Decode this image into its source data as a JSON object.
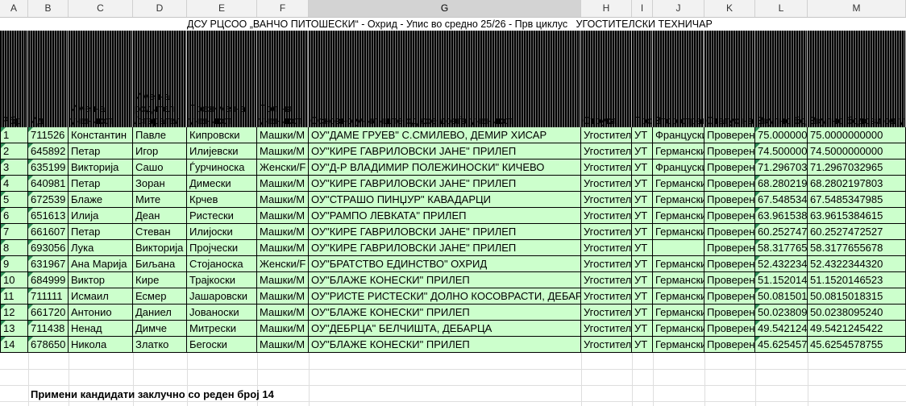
{
  "column_headers": [
    "A",
    "B",
    "C",
    "D",
    "E",
    "F",
    "G",
    "H",
    "I",
    "J",
    "K",
    "L",
    "M"
  ],
  "selected_column": "G",
  "title": "ДСУ РЦСОО „ВАНЧО ПИТОШЕСКИ“ - Охрид - Упис во средно 25/26 - Прв циклус   УГОСТИТЕЛСКИ ТЕХНИЧАР",
  "header": {
    "a": "Р.бр",
    "b": "Ид",
    "c": "Име на\nученикот",
    "d": "Име на\nродител\n/старател",
    "e": "Презиме на\nученикот",
    "f": "Пол на\nученикот",
    "g": "Основно училиште од кое доаѓа ученикот",
    "h": "Струка",
    "i": "Профил",
    "j": "Втор странски јазик",
    "k": "Статус на",
    "l": "Вкупно бодови",
    "m": "Вкупно бодови од успех"
  },
  "rows": [
    {
      "a": "1",
      "b": "711526",
      "c": "Константин",
      "d": "Павле",
      "e": "Кипровски",
      "f": "Машки/М",
      "g": "ОУ\"ДАМЕ ГРУЕВ\" С.СМИЛЕВО, ДЕМИР ХИСАР",
      "h": "Угостител",
      "i": "УТ",
      "j": "Француски",
      "k": "Проверен",
      "l": "75.000000",
      "m": "75.0000000000"
    },
    {
      "a": "2",
      "b": "645892",
      "c": "Петар",
      "d": "Игор",
      "e": "Илијевски",
      "f": "Машки/М",
      "g": "ОУ\"КИРЕ ГАВРИЛОВСКИ ЈАНЕ\" ПРИЛЕП",
      "h": "Угостител",
      "i": "УТ",
      "j": "Германски",
      "k": "Проверен",
      "l": "74.500000",
      "m": "74.5000000000"
    },
    {
      "a": "3",
      "b": "635199",
      "c": "Викторија",
      "d": "Сашо",
      "e": "Ѓурчиноска",
      "f": "Женски/F",
      "g": "ОУ\"Д-Р ВЛАДИМИР ПОЛЕЖИНОСКИ\" КИЧЕВО",
      "h": "Угостител",
      "i": "УТ",
      "j": "Француски",
      "k": "Проверен",
      "l": "71.296703",
      "m": "71.2967032965"
    },
    {
      "a": "4",
      "b": "640981",
      "c": "Петар",
      "d": "Зоран",
      "e": "Димески",
      "f": "Машки/М",
      "g": "ОУ\"КИРЕ ГАВРИЛОВСКИ ЈАНЕ\" ПРИЛЕП",
      "h": "Угостител",
      "i": "УТ",
      "j": "Германски",
      "k": "Проверен",
      "l": "68.280219",
      "m": "68.2802197803"
    },
    {
      "a": "5",
      "b": "672539",
      "c": "Блаже",
      "d": "Мите",
      "e": "Крчев",
      "f": "Машки/М",
      "g": "ОУ\"СТРАШО ПИНЏУР\" КАВАДАРЦИ",
      "h": "Угостител",
      "i": "УТ",
      "j": "Германски",
      "k": "Проверен",
      "l": "67.548534",
      "m": "67.5485347985"
    },
    {
      "a": "6",
      "b": "651613",
      "c": "Илија",
      "d": "Деан",
      "e": "Ристески",
      "f": "Машки/М",
      "g": "ОУ\"РАМПО ЛЕВКАТА\" ПРИЛЕП",
      "h": "Угостител",
      "i": "УТ",
      "j": "Германски",
      "k": "Проверен",
      "l": "63.961538",
      "m": "63.9615384615"
    },
    {
      "a": "7",
      "b": "661607",
      "c": "Петар",
      "d": "Стеван",
      "e": "Илијоски",
      "f": "Машки/М",
      "g": "ОУ\"КИРЕ ГАВРИЛОВСКИ ЈАНЕ\" ПРИЛЕП",
      "h": "Угостител",
      "i": "УТ",
      "j": "Германски",
      "k": "Проверен",
      "l": "60.252747",
      "m": "60.2527472527"
    },
    {
      "a": "8",
      "b": "693056",
      "c": "Лука",
      "d": "Викторија",
      "e": "Пројчески",
      "f": "Машки/М",
      "g": "ОУ\"КИРЕ ГАВРИЛОВСКИ ЈАНЕ\" ПРИЛЕП",
      "h": "Угостител",
      "i": "УТ",
      "j": "",
      "k": "Проверен",
      "l": "58.317765",
      "m": "58.3177655678"
    },
    {
      "a": "9",
      "b": "631967",
      "c": "Ана Марија",
      "d": "Биљана",
      "e": "Стојаноска",
      "f": "Женски/F",
      "g": "ОУ\"БРАТСТВО ЕДИНСТВО\" ОХРИД",
      "h": "Угостител",
      "i": "УТ",
      "j": "Германски",
      "k": "Проверен",
      "l": "52.432234",
      "m": "52.4322344320"
    },
    {
      "a": "10",
      "b": "684999",
      "c": "Виктор",
      "d": "Кире",
      "e": "Трајкоски",
      "f": "Машки/М",
      "g": "ОУ\"БЛАЖЕ КОНЕСКИ\" ПРИЛЕП",
      "h": "Угостител",
      "i": "УТ",
      "j": "Германски",
      "k": "Проверен",
      "l": "51.152014",
      "m": "51.1520146523"
    },
    {
      "a": "11",
      "b": "711111",
      "c": "Исмаил",
      "d": "Есмер",
      "e": "Јашаровски",
      "f": "Машки/М",
      "g": "ОУ\"РИСТЕ РИСТЕСКИ\" ДОЛНО КОСОВРАСТИ, ДЕБАР",
      "h": "Угостител",
      "i": "УТ",
      "j": "Германски",
      "k": "Проверен",
      "l": "50.081501",
      "m": "50.0815018315"
    },
    {
      "a": "12",
      "b": "661720",
      "c": "Антонио",
      "d": "Даниел",
      "e": "Јованоски",
      "f": "Машки/М",
      "g": "ОУ\"БЛАЖЕ КОНЕСКИ\" ПРИЛЕП",
      "h": "Угостител",
      "i": "УТ",
      "j": "Германски",
      "k": "Проверен",
      "l": "50.023809",
      "m": "50.0238095240"
    },
    {
      "a": "13",
      "b": "711438",
      "c": "Ненад",
      "d": "Димче",
      "e": "Митрески",
      "f": "Машки/М",
      "g": "ОУ\"ДЕБРЦА\" БЕЛЧИШТА, ДЕБАРЦА",
      "h": "Угостител",
      "i": "УТ",
      "j": "Германски",
      "k": "Проверен",
      "l": "49.542124",
      "m": "49.5421245422"
    },
    {
      "a": "14",
      "b": "678650",
      "c": "Никола",
      "d": "Златко",
      "e": "Бегоски",
      "f": "Машки/М",
      "g": "ОУ\"БЛАЖЕ КОНЕСКИ\" ПРИЛЕП",
      "h": "Угостител",
      "i": "УТ",
      "j": "Германски",
      "k": "Проверен",
      "l": "45.625457",
      "m": "45.6254578755"
    }
  ],
  "footer": "Примени  кандидати заклучно со реден број 14",
  "colors": {
    "row_fill": "#ccffcc",
    "header_fill": "#000000",
    "indicator": "#2e8b57"
  }
}
